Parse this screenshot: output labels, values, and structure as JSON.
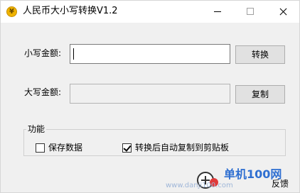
{
  "window": {
    "title": "人民币大小写转换V1.2",
    "app_icon_glyph": "¥"
  },
  "fields": {
    "lower_label": "小写金额:",
    "lower_value": "",
    "upper_label": "大写金额:",
    "upper_value": ""
  },
  "buttons": {
    "convert": "转换",
    "copy": "复制"
  },
  "group": {
    "title": "功能",
    "save_data_label": "保存数据",
    "save_data_checked": false,
    "auto_copy_label": "转换后自动复制到剪贴板",
    "auto_copy_checked": true
  },
  "footer": {
    "feedback": "反馈"
  },
  "watermark": {
    "text": "单机100网",
    "url": "www.danji100.com"
  },
  "colors": {
    "window_bg": "#f0f0f0",
    "titlebar_bg": "#ffffff",
    "watermark_blue": "#2f6fd1"
  }
}
